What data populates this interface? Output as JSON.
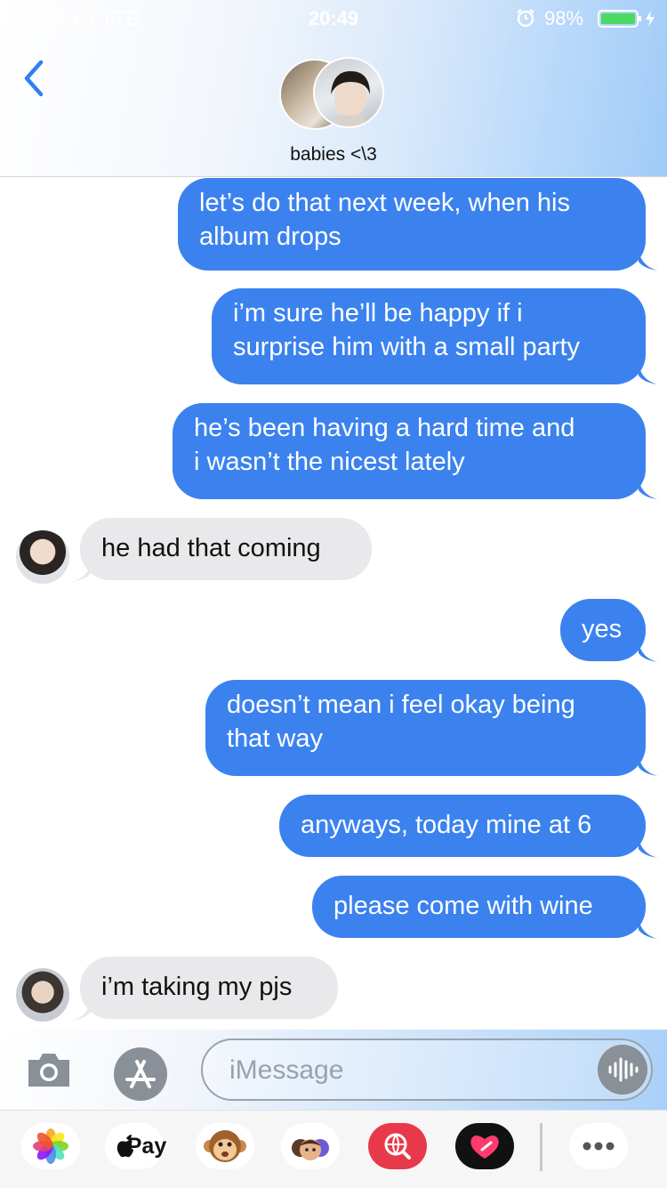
{
  "status_bar": {
    "carrier": "PLAY  LTE",
    "time": "20:49",
    "battery_percent": "98%"
  },
  "header": {
    "group_name": "babies <\\3"
  },
  "messages": [
    {
      "direction": "out",
      "lines": [
        "let’s do that next week, when his",
        "album drops"
      ]
    },
    {
      "direction": "out",
      "lines": [
        "i’m sure he’ll be happy if i",
        "surprise him with a small party"
      ]
    },
    {
      "direction": "out",
      "lines": [
        "he’s been having a hard time and",
        "i wasn’t the nicest lately"
      ]
    },
    {
      "direction": "in",
      "lines": [
        "he had that coming"
      ]
    },
    {
      "direction": "out",
      "lines": [
        "yes"
      ]
    },
    {
      "direction": "out",
      "lines": [
        "doesn’t mean i feel okay being",
        "that way"
      ]
    },
    {
      "direction": "out",
      "lines": [
        "anyways, today mine at 6"
      ]
    },
    {
      "direction": "out",
      "lines": [
        "please come with wine"
      ]
    },
    {
      "direction": "in",
      "lines": [
        "i’m taking my pjs"
      ]
    }
  ],
  "composer": {
    "placeholder": "iMessage"
  },
  "app_drawer": {
    "apps": [
      "photos-icon",
      "apple-pay-icon",
      "animoji-icon",
      "memoji-icon",
      "image-search-icon",
      "digital-touch-icon",
      "more-icon"
    ],
    "apple_pay_label": "Pay"
  },
  "colors": {
    "outgoing_bubble": "#3b82ef",
    "incoming_bubble": "#e9e9ec"
  }
}
